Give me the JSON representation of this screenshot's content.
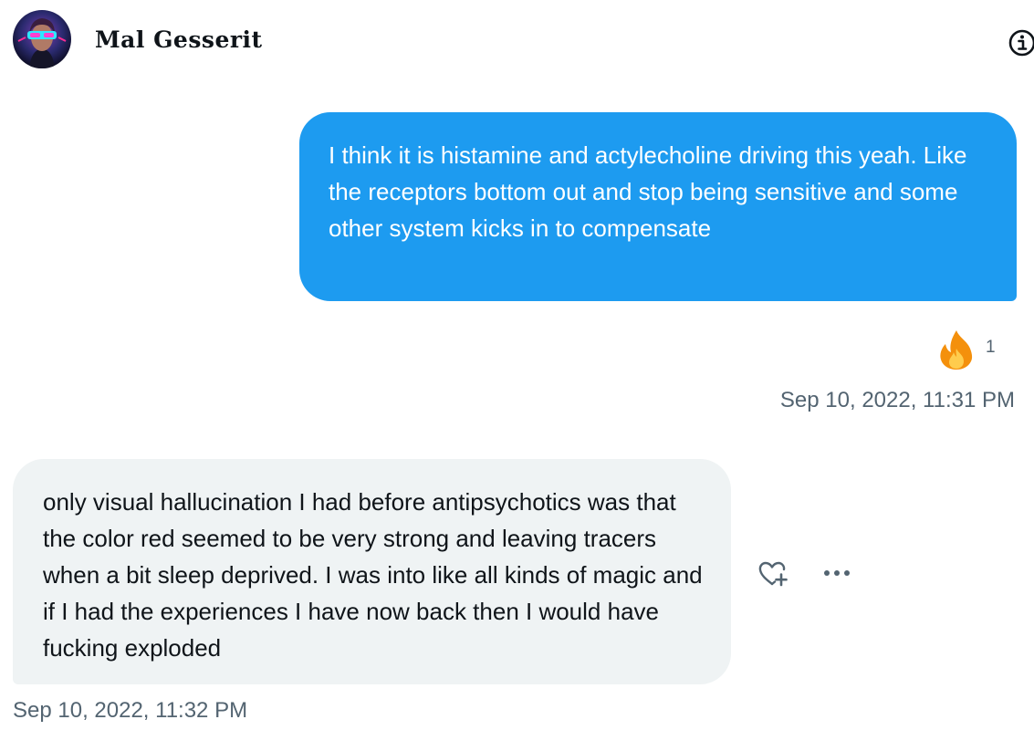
{
  "conversation": {
    "contact_name": "Mal Gesserit"
  },
  "icons": {
    "info": "info-icon",
    "reaction": "fire-emoji",
    "like": "heart-plus-icon",
    "more": "more-dots-icon"
  },
  "colors": {
    "sent_bubble": "#1d9bf0",
    "received_bubble": "#eff3f4",
    "secondary_text": "#536471",
    "primary_text": "#0f1419"
  },
  "messages": [
    {
      "direction": "sent",
      "text": "I think it is histamine and actylecholine driving this yeah. Like the receptors bottom out and stop being sensitive and some other system kicks in to compensate",
      "reaction_count": "1",
      "timestamp": "Sep 10, 2022, 11:31 PM"
    },
    {
      "direction": "received",
      "text": "only visual hallucination I had before antipsychotics was that the color red seemed to be very strong and leaving tracers when a bit sleep deprived. I was into like all kinds of magic and if I had the experiences I have now back then I would have fucking exploded",
      "timestamp": "Sep 10, 2022, 11:32 PM"
    }
  ]
}
